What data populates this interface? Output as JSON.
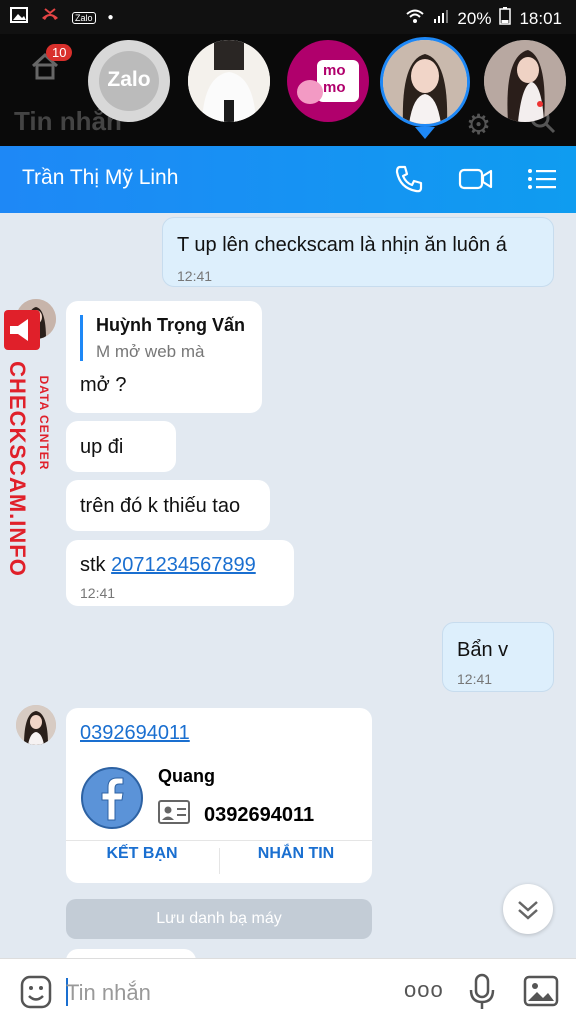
{
  "status_bar": {
    "battery": "20%",
    "time": "18:01",
    "app_icon_label": "Zalo"
  },
  "chat_heads": {
    "home_badge": "10",
    "zalo_label": "Zalo",
    "momo_label": "mo\nmo"
  },
  "background_screen": {
    "title": "Tin nhắn"
  },
  "header": {
    "contact_name": "Trần Thị Mỹ Linh"
  },
  "messages": [
    {
      "id": "m1",
      "text": "T up lên checkscam là nhịn ăn luôn á",
      "time": "12:41",
      "mine": true
    },
    {
      "id": "m2",
      "quote_author": "Huỳnh Trọng Vấn",
      "quote_text": "M mở web mà",
      "text": "mở ?",
      "mine": false
    },
    {
      "id": "m3",
      "text": "up đi",
      "mine": false
    },
    {
      "id": "m4",
      "text": "trên đó k thiếu tao",
      "mine": false
    },
    {
      "id": "m5",
      "prefix": "stk",
      "link": "2071234567899",
      "time": "12:41",
      "mine": false
    },
    {
      "id": "m6",
      "text": "Bẩn v",
      "time": "12:41",
      "mine": true
    }
  ],
  "contact_card": {
    "phone_link": "0392694011",
    "name": "Quang",
    "phone": "0392694011",
    "add_friend": "KẾT BẠN",
    "message": "NHẮN TIN",
    "save_contact": "Lưu danh bạ máy"
  },
  "watermark": {
    "vertical_brand": "CHECKSCAM.INFO",
    "vertical_sub": "DATA CENTER"
  },
  "input": {
    "placeholder": "Tin nhắn",
    "more": "ooo"
  },
  "colors": {
    "accent": "#1e88f6",
    "link": "#1a6fd0",
    "my_bubble": "#ddeffc",
    "watermark": "#e0202a"
  }
}
